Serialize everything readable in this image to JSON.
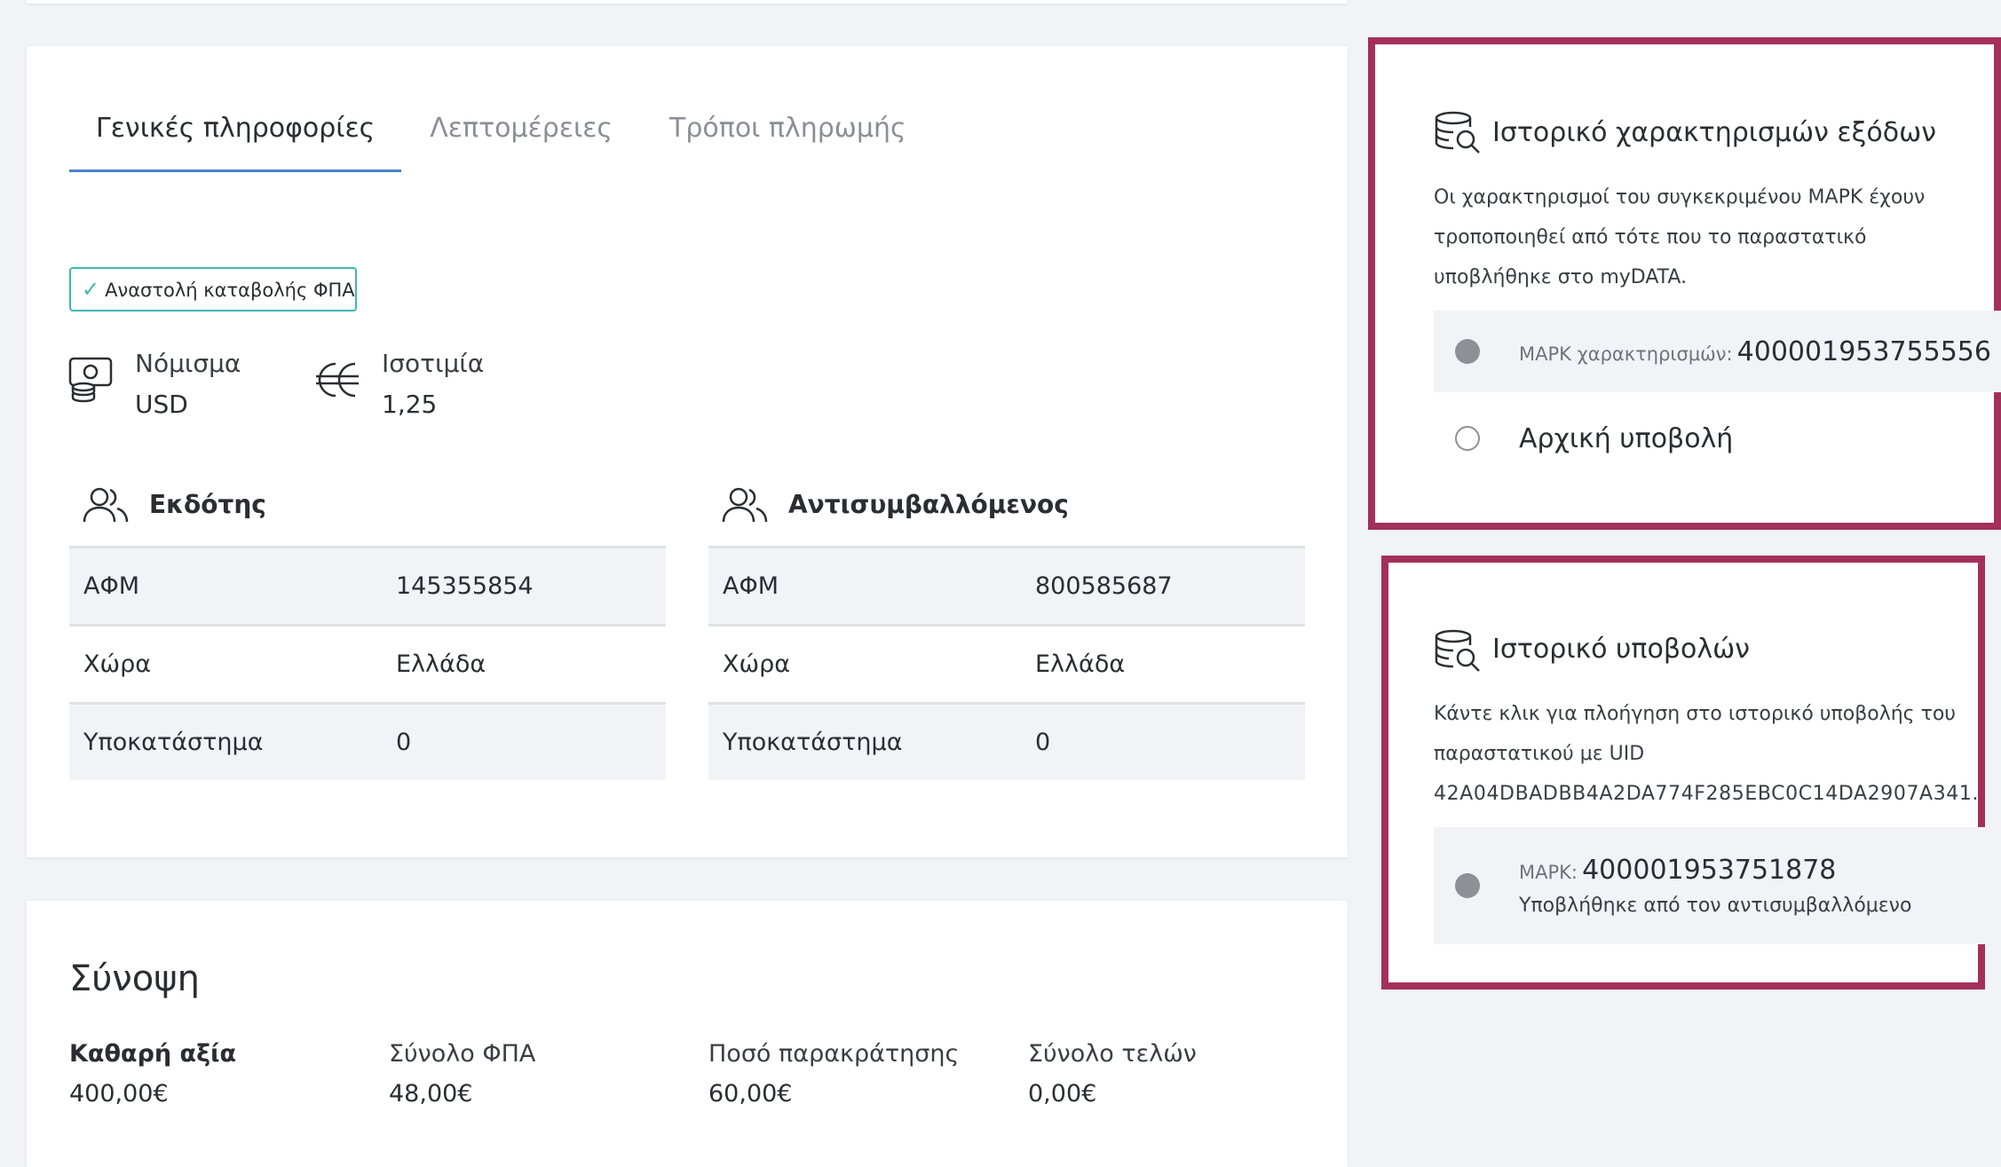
{
  "tabs": [
    {
      "label": "Γενικές πληροφορίες"
    },
    {
      "label": "Λεπτομέρειες"
    },
    {
      "label": "Τρόποι πληρωμής"
    }
  ],
  "badge": {
    "label": "Αναστολή καταβολής ΦΠΑ"
  },
  "currency": {
    "label": "Νόμισμα",
    "value": "USD"
  },
  "rate": {
    "label": "Ισοτιμία",
    "value": "1,25"
  },
  "issuer": {
    "title": "Εκδότης",
    "rows": [
      {
        "k": "ΑΦΜ",
        "v": "145355854"
      },
      {
        "k": "Χώρα",
        "v": "Ελλάδα"
      },
      {
        "k": "Υποκατάστημα",
        "v": "0"
      }
    ]
  },
  "counterpart": {
    "title": "Αντισυμβαλλόμενος",
    "rows": [
      {
        "k": "ΑΦΜ",
        "v": "800585687"
      },
      {
        "k": "Χώρα",
        "v": "Ελλάδα"
      },
      {
        "k": "Υποκατάστημα",
        "v": "0"
      }
    ]
  },
  "expense_history": {
    "title": "Ιστορικό χαρακτηρισμών εξόδων",
    "desc_lines": [
      "Οι χαρακτηρισμοί του συγκεκριμένου ΜΑΡΚ έχουν",
      "τροποποιηθεί από τότε που το παραστατικό",
      "υποβλήθηκε στο myDATA."
    ],
    "mark_label": "ΜΑΡΚ χαρακτηρισμών:",
    "mark_value": "400001953755556",
    "initial_label": "Αρχική υποβολή"
  },
  "submission_history": {
    "title": "Ιστορικό υποβολών",
    "desc_lines": [
      "Κάντε κλικ για πλοήγηση στο ιστορικό υποβολής του",
      "παραστατικού με UID",
      "42A04DBADBB4A2DA774F285EBC0C14DA2907A341."
    ],
    "mark_label": "ΜΑΡΚ:",
    "mark_value": "400001953751878",
    "submitted_by": "Υποβλήθηκε από τον αντισυμβαλλόμενο"
  },
  "summary": {
    "title": "Σύνοψη",
    "items": [
      {
        "label": "Καθαρή αξία",
        "value": "400,00€"
      },
      {
        "label": "Σύνολο ΦΠΑ",
        "value": "48,00€"
      },
      {
        "label": "Ποσό παρακράτησης",
        "value": "60,00€"
      },
      {
        "label": "Σύνολο τελών",
        "value": "0,00€"
      }
    ]
  }
}
